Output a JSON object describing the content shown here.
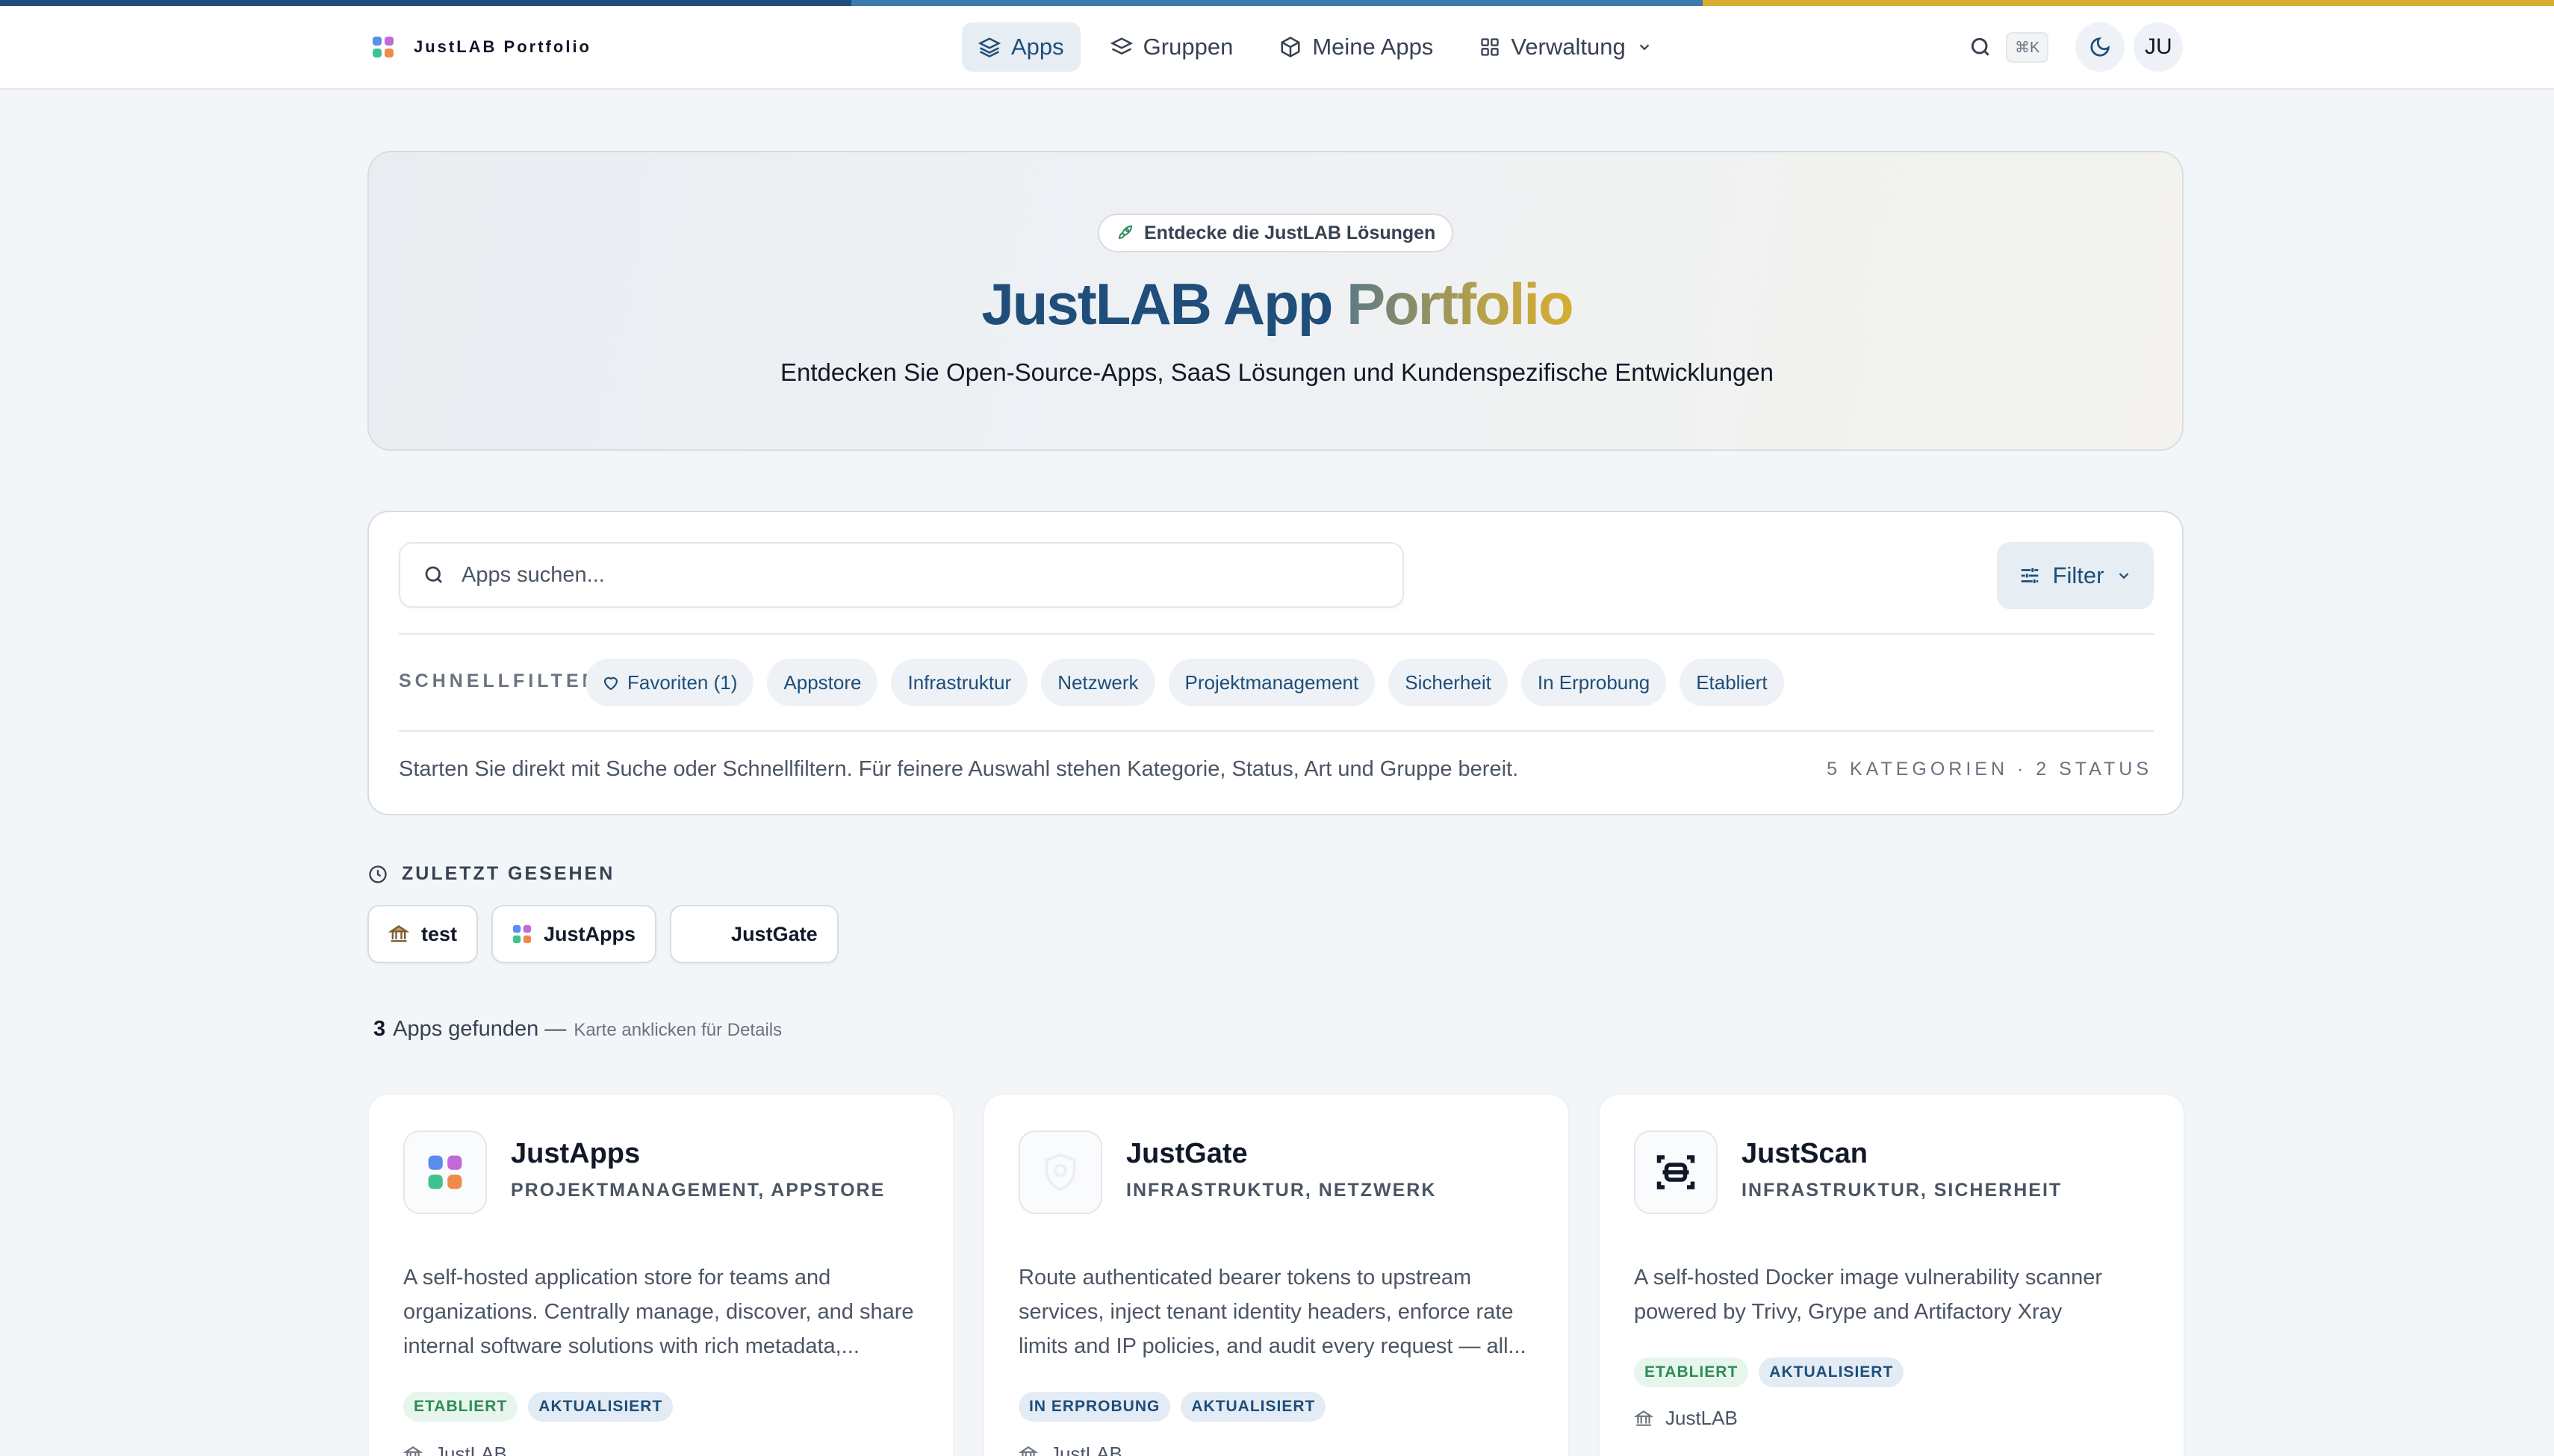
{
  "colors": {
    "strip": [
      "#1e4e79",
      "#3b7bb0",
      "#d7ad31"
    ],
    "accent": "#1e4e79",
    "gold": "#d7ad31"
  },
  "header": {
    "brand": "JustLAB Portfolio",
    "nav": [
      {
        "label": "Apps",
        "icon": "layers-icon"
      },
      {
        "label": "Gruppen",
        "icon": "stack-icon"
      },
      {
        "label": "Meine Apps",
        "icon": "package-icon"
      },
      {
        "label": "Verwaltung",
        "icon": "grid-icon"
      }
    ],
    "shortcut": "⌘K",
    "avatar": "JU"
  },
  "hero": {
    "pill": "Entdecke die JustLAB Lösungen",
    "title_part1": "JustLAB App ",
    "title_part2": "Portfolio",
    "subtitle": "Entdecken Sie Open-Source-Apps, SaaS Lösungen und Kundenspezifische Entwicklungen"
  },
  "search": {
    "placeholder": "Apps suchen...",
    "filter_label": "Filter",
    "quick_label": "SCHNELLFILTER",
    "chips": [
      "Favoriten (1)",
      "Appstore",
      "Infrastruktur",
      "Netzwerk",
      "Projektmanagement",
      "Sicherheit",
      "In Erprobung",
      "Etabliert"
    ],
    "hint": "Starten Sie direkt mit Suche oder Schnellfiltern. Für feinere Auswahl stehen Kategorie, Status, Art und Gruppe bereit.",
    "stats": "5 KATEGORIEN · 2 STATUS"
  },
  "recent": {
    "heading": "ZULETZT GESEHEN",
    "items": [
      "test",
      "JustApps",
      "JustGate"
    ]
  },
  "results": {
    "count": "3",
    "label": "Apps gefunden —",
    "hint": "Karte anklicken für Details"
  },
  "cards": [
    {
      "title": "JustApps",
      "categories": "PROJEKTMANAGEMENT, APPSTORE",
      "description": "A self-hosted application store for teams and organizations. Centrally manage, discover, and share internal software solutions with rich metadata,...",
      "badges": [
        "ETABLIERT",
        "AKTUALISIERT"
      ],
      "org": "JustLAB"
    },
    {
      "title": "JustGate",
      "categories": "INFRASTRUKTUR, NETZWERK",
      "description": "Route authenticated bearer tokens to upstream services, inject tenant identity headers, enforce rate limits and IP policies, and audit every request — all...",
      "badges": [
        "IN ERPROBUNG",
        "AKTUALISIERT"
      ],
      "org": "JustLAB"
    },
    {
      "title": "JustScan",
      "categories": "INFRASTRUKTUR, SICHERHEIT",
      "description": "A self-hosted Docker image vulnerability scanner powered by Trivy, Grype and Artifactory Xray",
      "badges": [
        "ETABLIERT",
        "AKTUALISIERT"
      ],
      "org": "JustLAB"
    }
  ]
}
